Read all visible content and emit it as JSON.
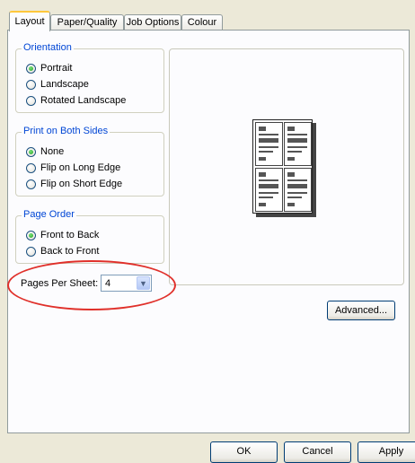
{
  "tabs": [
    {
      "label": "Layout",
      "active": true
    },
    {
      "label": "Paper/Quality",
      "active": false
    },
    {
      "label": "Job Options",
      "active": false
    },
    {
      "label": "Colour",
      "active": false
    }
  ],
  "orientation": {
    "title": "Orientation",
    "options": [
      "Portrait",
      "Landscape",
      "Rotated Landscape"
    ],
    "selected": "Portrait"
  },
  "both_sides": {
    "title": "Print on Both Sides",
    "options": [
      "None",
      "Flip on Long Edge",
      "Flip on Short Edge"
    ],
    "selected": "None"
  },
  "page_order": {
    "title": "Page Order",
    "options": [
      "Front to Back",
      "Back to Front"
    ],
    "selected": "Front to Back"
  },
  "pages_per_sheet": {
    "label": "Pages Per Sheet:",
    "value": "4"
  },
  "buttons": {
    "advanced": "Advanced...",
    "ok": "OK",
    "cancel": "Cancel",
    "apply": "Apply"
  },
  "colors": {
    "highlight": "#e0302a",
    "legend": "#0046d5",
    "tab_accent": "#ffc83c",
    "radio_selected": "#21a121"
  },
  "icons": {
    "preview": "page-layout-preview-icon",
    "dropdown": "chevron-down-icon"
  }
}
